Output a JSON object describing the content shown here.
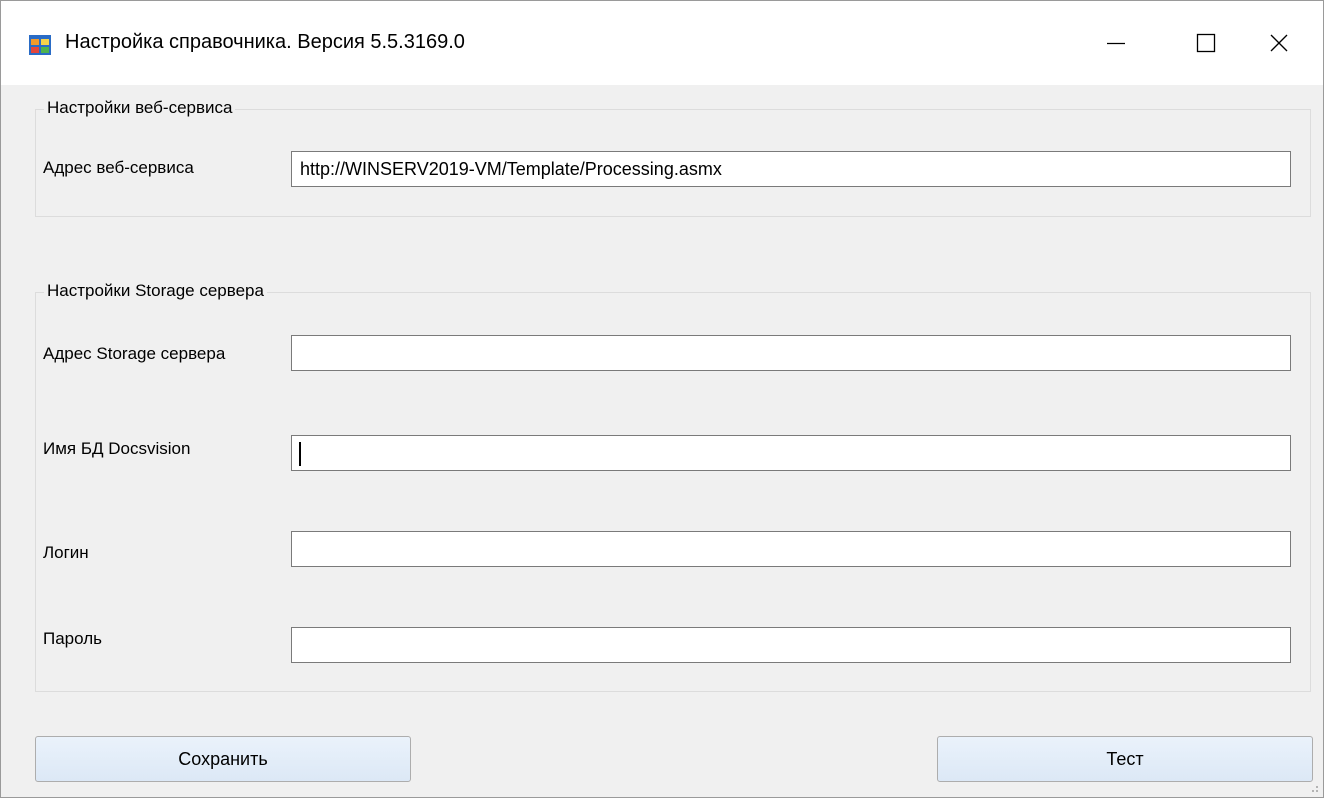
{
  "window": {
    "title": "Настройка справочника. Версия  5.5.3169.0",
    "app_icon": "app-window-icon",
    "controls": {
      "minimize_icon": "minimize-icon",
      "maximize_icon": "maximize-icon",
      "close_icon": "close-icon"
    }
  },
  "web_service": {
    "legend": "Настройки веб-сервиса",
    "address_label": "Адрес веб-сервиса",
    "address_value": "http://WINSERV2019-VM/Template/Processing.asmx"
  },
  "storage": {
    "legend": "Настройки Storage сервера",
    "address_label": "Адрес Storage сервера",
    "address_value": "",
    "db_label": "Имя БД Docsvision",
    "db_value": "",
    "login_label": "Логин",
    "login_value": "",
    "password_label": "Пароль",
    "password_value": ""
  },
  "buttons": {
    "save_label": "Сохранить",
    "test_label": "Тест"
  },
  "colors": {
    "window_bg": "#f0f0f0",
    "titlebar_bg": "#ffffff",
    "button_bg": "#e1ecf8",
    "field_border": "#7a7a7a"
  }
}
